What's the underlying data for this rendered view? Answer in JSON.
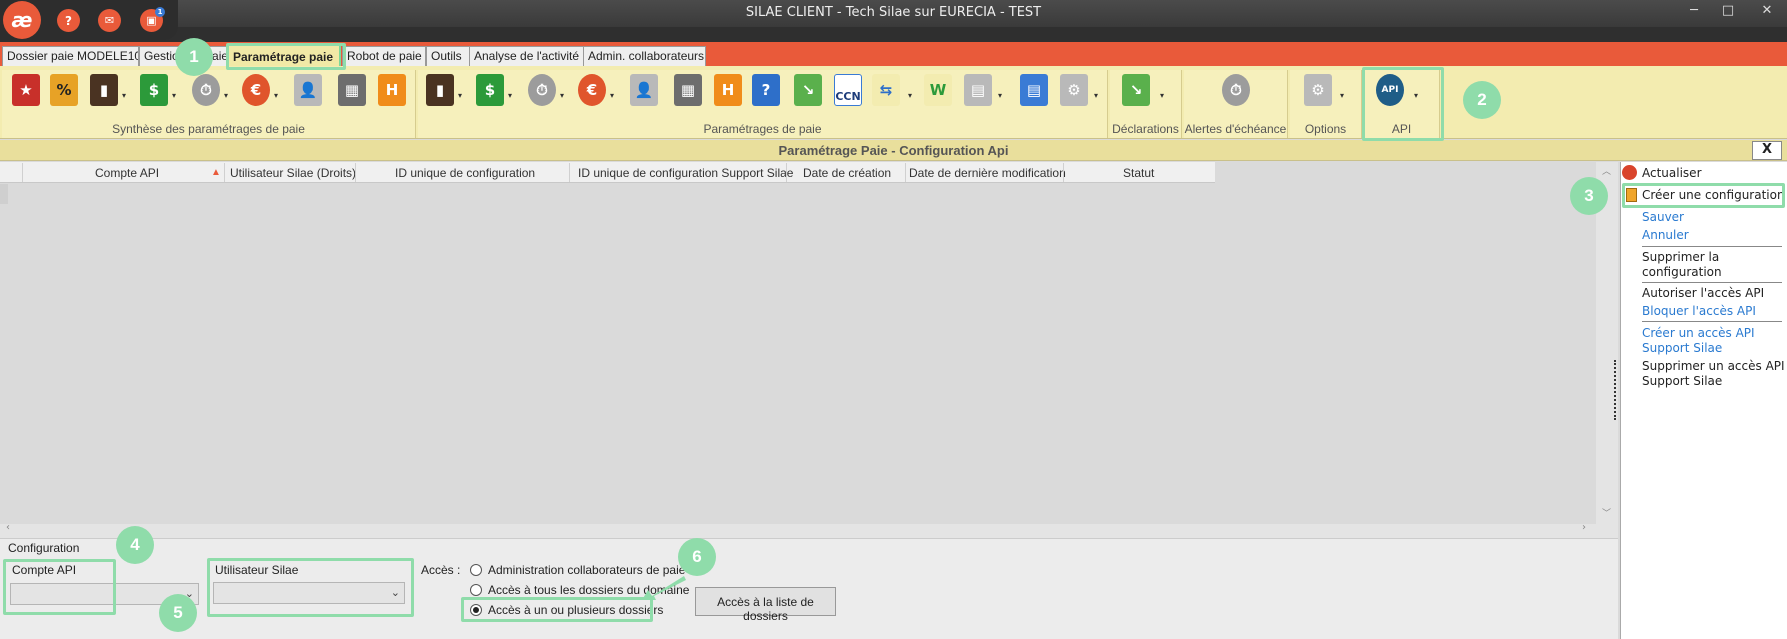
{
  "window": {
    "title": "SILAE CLIENT - Tech Silae sur EURECIA - TEST",
    "minimize": "─",
    "maximize": "□",
    "close": "✕"
  },
  "top_buttons": {
    "help": "?",
    "notification_count": "1"
  },
  "tabs": [
    "Dossier paie MODELE10",
    "Gestion de paie",
    "Paramétrage paie",
    "Robot de paie",
    "Outils",
    "Analyse de l'activité",
    "Admin. collaborateurs"
  ],
  "ribbon": {
    "groups": [
      "Synthèse des paramétrages de paie",
      "Paramétrages de paie",
      "Déclarations",
      "Alertes d'échéance",
      "Options",
      "API"
    ],
    "ccn_label": "CCN",
    "api_icon_text": "API"
  },
  "section_title": "Paramétrage Paie - Configuration Api",
  "close_button": "X",
  "grid": {
    "columns": [
      "Compte API",
      "Utilisateur Silae (Droits)",
      "ID unique de configuration",
      "ID unique de configuration Support Silae",
      "Date de création",
      "Date de dernière modification",
      "Statut"
    ]
  },
  "right_panel": {
    "actualiser": "Actualiser",
    "creer_config": "Créer une configuration",
    "sauver": "Sauver",
    "annuler": "Annuler",
    "supprimer_config_1": "Supprimer la",
    "supprimer_config_2": "configuration",
    "autoriser": "Autoriser l'accès API",
    "bloquer": "Bloquer l'accès API",
    "creer_acces_1": "Créer un accès API",
    "creer_acces_2": "Support Silae",
    "supprimer_acces_1": "Supprimer un accès API",
    "supprimer_acces_2": "Support Silae"
  },
  "config": {
    "title": "Configuration",
    "compte_api_label": "Compte API",
    "compte_api_value": "",
    "utilisateur_label": "Utilisateur Silae",
    "utilisateur_value": "",
    "acces_label": "Accès :",
    "radio_options": [
      "Administration collaborateurs de paie",
      "Accès à tous les dossiers du domaine",
      "Accès à un ou plusieurs dossiers"
    ],
    "selected_radio": 2,
    "dossiers_button": "Accès à la liste de dossiers"
  },
  "annotations": [
    "1",
    "2",
    "3",
    "4",
    "5",
    "6"
  ],
  "colors": {
    "accent_orange": "#e95a3a",
    "ribbon_yellow": "#f3ecb0",
    "highlight_green": "#8fdcaa",
    "link_blue": "#2a7ad0"
  }
}
